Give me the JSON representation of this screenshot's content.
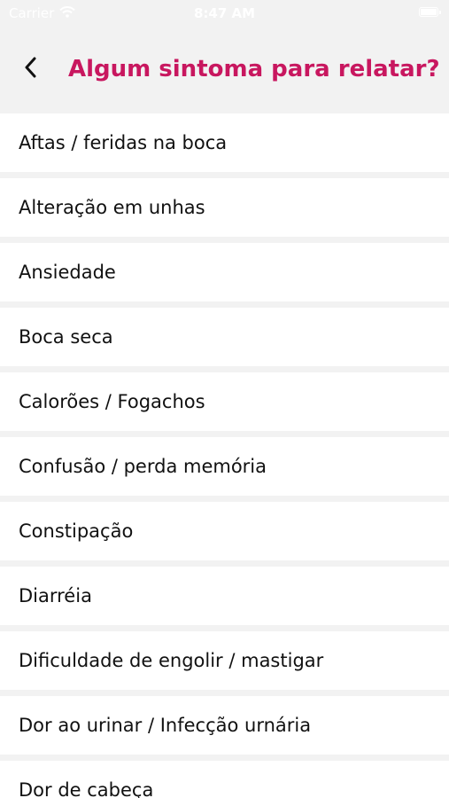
{
  "status_bar": {
    "carrier": "Carrier",
    "time": "8:47 AM",
    "wifi_icon": "wifi-icon",
    "battery_icon": "battery-icon"
  },
  "header": {
    "back_icon": "chevron-left-icon",
    "title": "Algum sintoma para relatar?",
    "title_color": "#c8175f"
  },
  "symptoms": [
    "Aftas / feridas na boca",
    "Alteração em unhas",
    "Ansiedade",
    "Boca seca",
    "Calorões / Fogachos",
    "Confusão / perda memória",
    "Constipação",
    "Diarréia",
    "Dificuldade de engolir / mastigar",
    "Dor ao urinar / Infecção urnária",
    "Dor de cabeça"
  ]
}
